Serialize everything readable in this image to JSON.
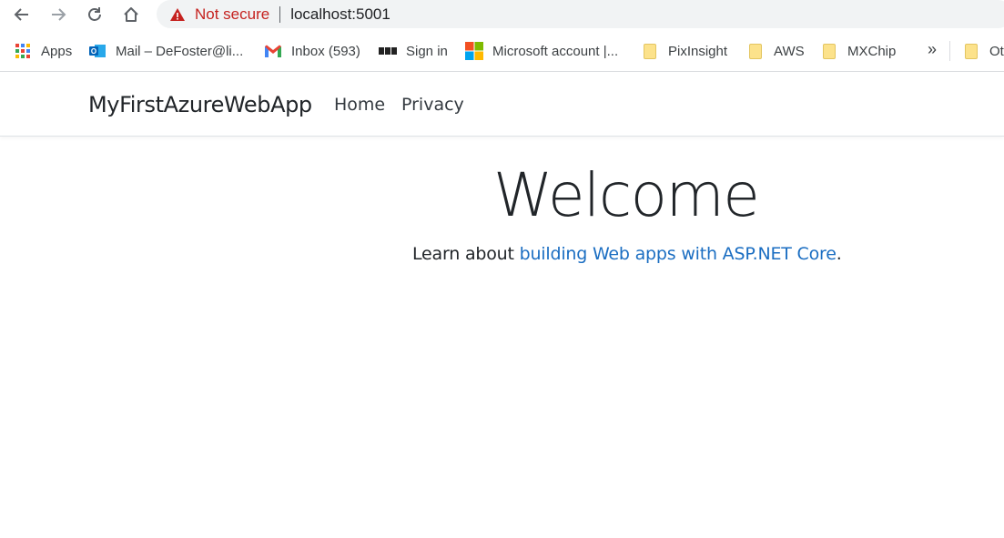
{
  "browser": {
    "security_label": "Not secure",
    "url": "localhost:5001",
    "bookmarks": [
      {
        "label": "Apps",
        "icon": "apps-grid-icon"
      },
      {
        "label": "Mail – DeFoster@li...",
        "icon": "outlook-icon"
      },
      {
        "label": "Inbox (593)",
        "icon": "gmail-icon"
      },
      {
        "label": "Sign in",
        "icon": "bbc-icon"
      },
      {
        "label": "Microsoft account |...",
        "icon": "microsoft-icon"
      },
      {
        "label": "PixInsight",
        "icon": "folder-icon"
      },
      {
        "label": "AWS",
        "icon": "folder-icon"
      },
      {
        "label": "MXChip",
        "icon": "folder-icon"
      },
      {
        "label": "Ot",
        "icon": "folder-icon"
      }
    ],
    "overflow_label": "»"
  },
  "navbar": {
    "brand": "MyFirstAzureWebApp",
    "links": [
      "Home",
      "Privacy"
    ]
  },
  "main": {
    "heading": "Welcome",
    "intro_prefix": "Learn about ",
    "intro_link": "building Web apps with ASP.NET Core",
    "intro_suffix": "."
  },
  "colors": {
    "link": "#1b6ec2",
    "warning": "#c5221f"
  }
}
